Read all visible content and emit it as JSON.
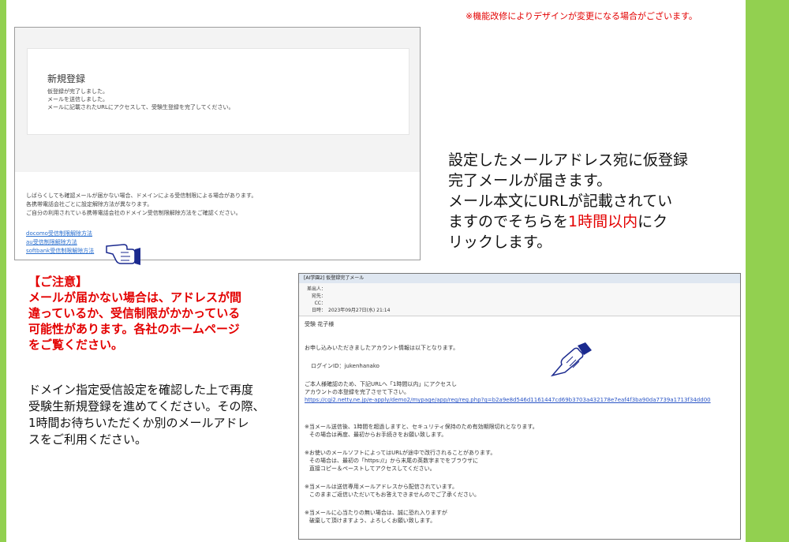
{
  "top_notice": "※機能改修によりデザインが変更になる場合がございます。",
  "registration_screen": {
    "title": "新規登録",
    "lines": [
      "仮登録が完了しました。",
      "メールを送信しました。",
      "メールに記載されたURLにアクセスして、受験生登録を完了してください。"
    ],
    "help_lines": [
      "しばらくしても確認メールが届かない場合、ドメインによる受信制限による場合があります。",
      "各携帯電話会社ごとに設定解除方法が異なります。",
      "ご自分の利用されている携帯電話会社のドメイン受信制限解除方法をご確認ください。"
    ],
    "links": [
      "docomo受信制限解除方法",
      "au受信制限解除方法",
      "softbank受信制限解除方法"
    ]
  },
  "description": {
    "line1": "設定したメールアドレス宛に仮登録",
    "line2": "完了メールが届きます。",
    "line3": "メール本文にURLが記載されてい",
    "line4": "ますのでそちらを",
    "highlight": "1時間以内",
    "line4_end": "にク",
    "line5": "リックします。"
  },
  "caution": {
    "heading": "【ご注意】",
    "line1": "メールが届かない場合は、アドレスが間",
    "line2": "違っているか、受信制限がかかっている",
    "line3": "可能性があります。各社のホームページ",
    "line4": "をご覧ください。"
  },
  "domain_note": {
    "line1": "ドメイン指定受信設定を確認した上で再度",
    "line2": "受験生新規登録を進めてください。その際、",
    "line3": "1時間お待ちいただくか別のメールアドレ",
    "line4": "スをご利用ください。"
  },
  "email": {
    "subject": "[AI学園2] 仮登録完了メール",
    "from_label": "差出人：",
    "to_label": "宛先：",
    "cc_label": "CC：",
    "date_label": "日時：",
    "date_value": "2023年09月27日(水) 21:14",
    "recipient": "受験 花子様",
    "body": [
      "お申し込みいただきましたアカウント情報は以下となります。",
      "ログインID：jukenhanako",
      "ご本人様確認のため、下記URLへ「1時間以内」にアクセスし",
      "アカウントの本登録を完了させて下さい。",
      "https://cgi2.netty.ne.jp/e-apply/demo2/mypage/app/reg/reg.php?q=b2a9e8d546d1161447cd69b3703a432178e7eaf4f3ba90da7739a1713f34dd00",
      "※当メール送信後、1時間を超過しますと、セキュリティ保持のため有効期限切れとなります。",
      "その場合は再度、最初からお手続きをお願い致します。",
      "※お使いのメールソフトによってはURLが途中で改行されることがあります。",
      "その場合は、最初の「https://」から末尾の英数字までをブラウザに",
      "直接コピー＆ペーストしてアクセスしてください。",
      "※当メールは送信専用メールアドレスから配信されています。",
      "このままご返信いただいてもお答えできませんのでご了承ください。",
      "※当メールに心当たりの無い場合は、誠に恐れ入りますが",
      "破棄して頂けますよう、よろしくお願い致します。"
    ]
  },
  "colors": {
    "accent_green": "#92d050",
    "warning_red": "#e30000",
    "link_blue": "#2a6fcf"
  },
  "icons": [
    "pointing-hand-icon",
    "pointing-hand-icon"
  ]
}
